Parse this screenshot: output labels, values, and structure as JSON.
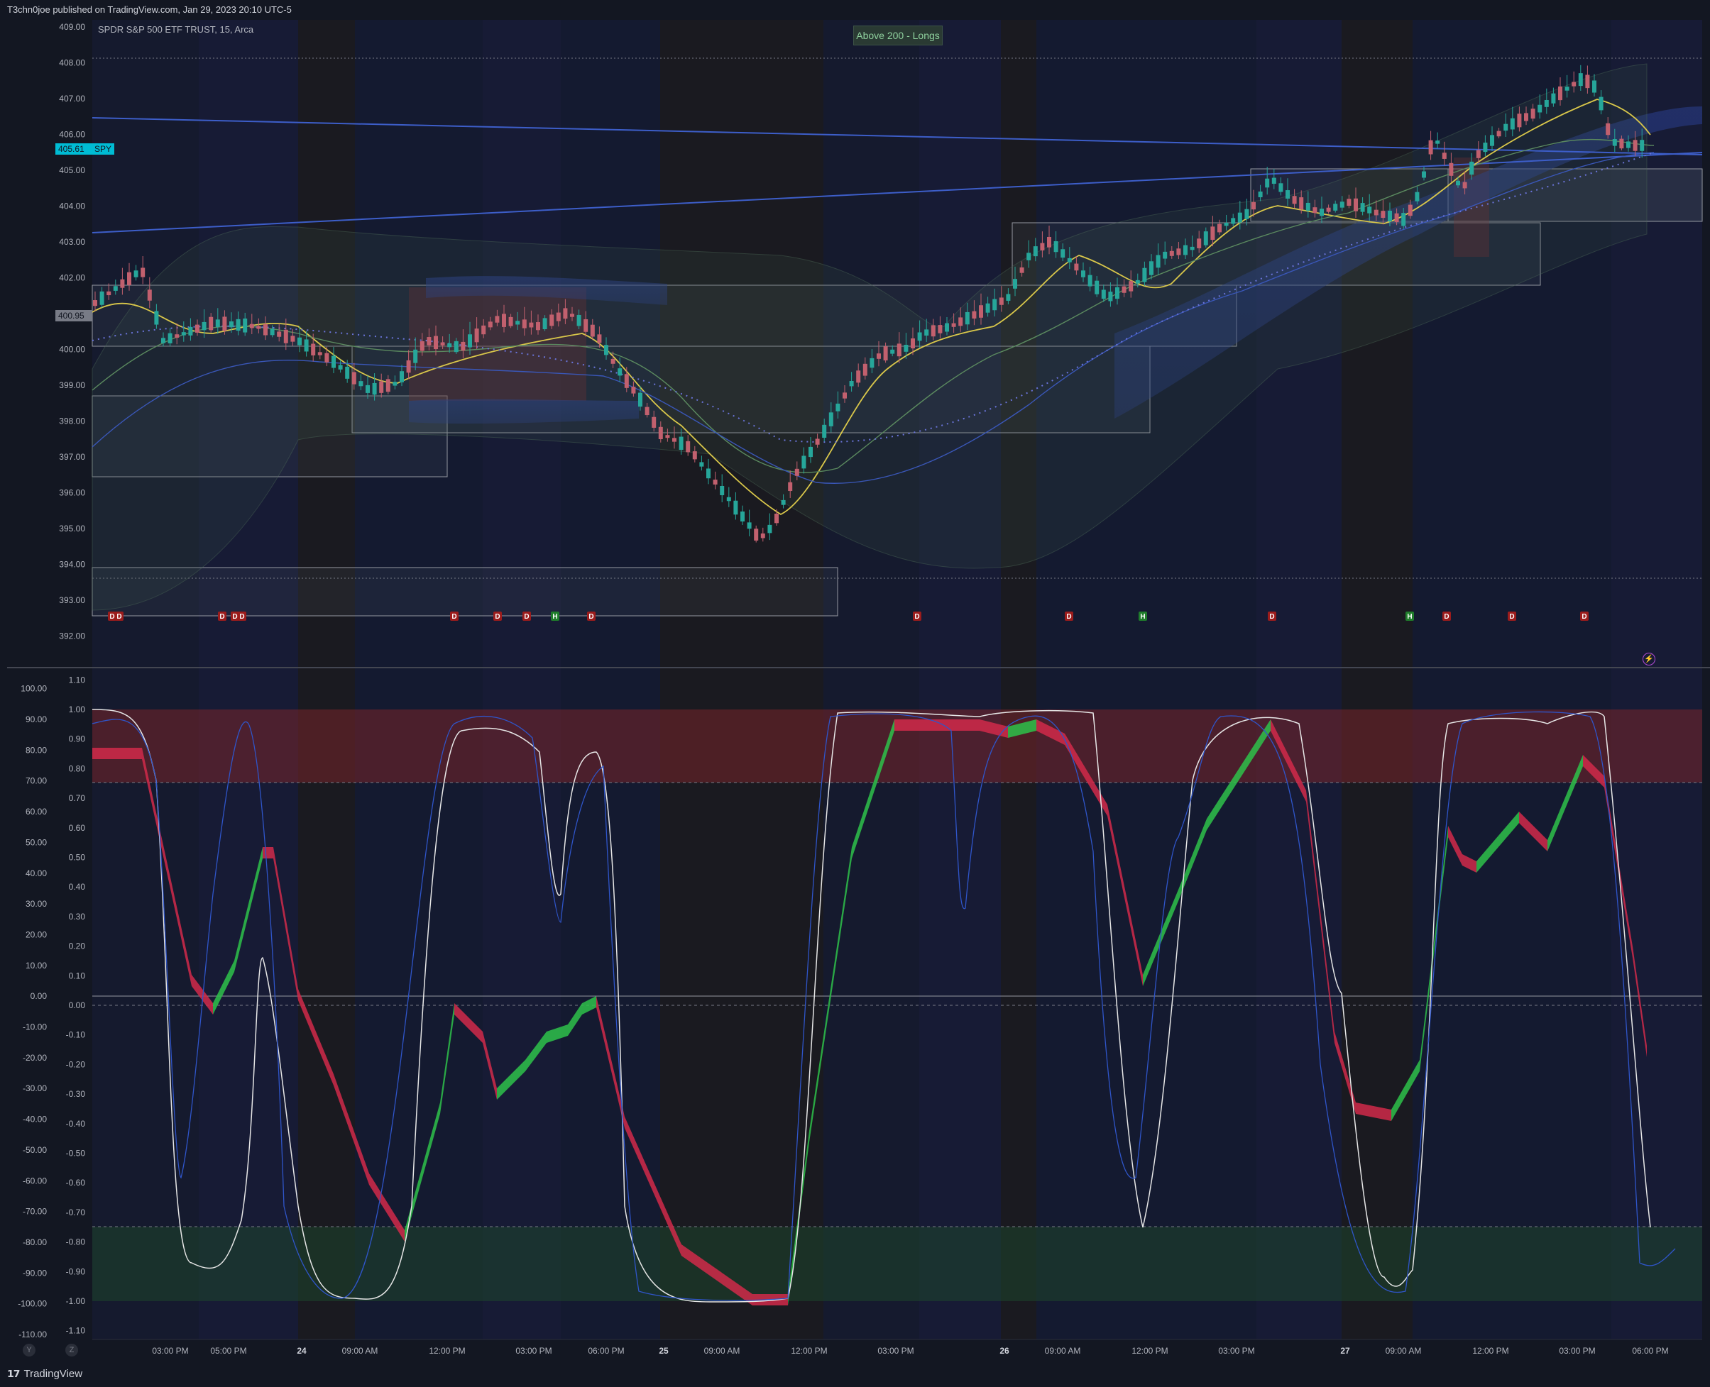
{
  "header": {
    "publish_line": "T3chn0joe published on TradingView.com, Jan 29, 2023 20:10 UTC-5"
  },
  "chart": {
    "symbol_line": "SPDR S&P 500 ETF TRUST, 15, Arca",
    "status_badge": "Above 200 - Longs",
    "price_labels": [
      "409.00",
      "408.00",
      "407.00",
      "406.00",
      "405.00",
      "404.00",
      "403.00",
      "402.00",
      "401.00",
      "400.00",
      "399.00",
      "398.00",
      "397.00",
      "396.00",
      "395.00",
      "394.00",
      "393.00",
      "392.00"
    ],
    "last_price_tag": "405.61",
    "symbol_tag": "SPY",
    "crosshair_price_tag": "400.95",
    "markers": [
      "D",
      "D",
      "D",
      "D",
      "D",
      "D",
      "D",
      "D",
      "H",
      "D",
      "D",
      "D",
      "H",
      "D",
      "H",
      "D",
      "D",
      "D"
    ]
  },
  "oscillator": {
    "left_axis": [
      "1.10",
      "1.00",
      "0.90",
      "0.80",
      "0.70",
      "0.60",
      "0.50",
      "0.40",
      "0.30",
      "0.20",
      "0.10",
      "0.00",
      "-0.10",
      "-0.20",
      "-0.30",
      "-0.40",
      "-0.50",
      "-0.60",
      "-0.70",
      "-0.80",
      "-0.90",
      "-1.00",
      "-1.10"
    ],
    "right_axis": [
      "100.00",
      "90.00",
      "80.00",
      "70.00",
      "60.00",
      "50.00",
      "40.00",
      "30.00",
      "20.00",
      "10.00",
      "0.00",
      "-10.00",
      "-20.00",
      "-30.00",
      "-40.00",
      "-50.00",
      "-60.00",
      "-70.00",
      "-80.00",
      "-90.00",
      "-100.00",
      "-110.00"
    ]
  },
  "time_axis": [
    "03:00 PM",
    "05:00 PM",
    "24",
    "09:00 AM",
    "12:00 PM",
    "03:00 PM",
    "06:00 PM",
    "25",
    "09:00 AM",
    "12:00 PM",
    "03:00 PM",
    "26",
    "09:00 AM",
    "12:00 PM",
    "03:00 PM",
    "27",
    "09:00 AM",
    "12:00 PM",
    "03:00 PM",
    "06:00 PM"
  ],
  "footer": {
    "brand": "TradingView",
    "btn_y": "Y",
    "btn_z": "Z"
  },
  "colors": {
    "background": "#131722",
    "bull": "#26a69a",
    "bear": "#c2606e",
    "overbought": "#5a2226",
    "oversold": "#1e3a27"
  },
  "icons": [
    "alert-lightning-icon",
    "tradingview-logo-icon"
  ]
}
